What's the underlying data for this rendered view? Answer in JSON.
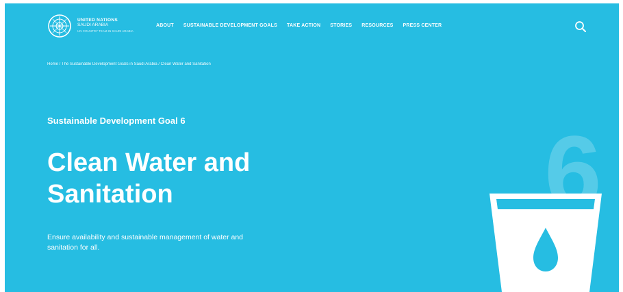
{
  "brand": {
    "line1": "UNITED NATIONS",
    "line2": "SAUDI ARABIA",
    "line3": "UN COUNTRY TEAM IN SAUDI ARABIA"
  },
  "nav": {
    "items": [
      {
        "label": "ABOUT"
      },
      {
        "label": "SUSTAINABLE DEVELOPMENT GOALS"
      },
      {
        "label": "TAKE ACTION"
      },
      {
        "label": "STORIES"
      },
      {
        "label": "RESOURCES"
      },
      {
        "label": "PRESS CENTER"
      }
    ]
  },
  "breadcrumb": "Home / The Sustainable Development Goals in Saudi Arabia / Clean Water and Sanitation",
  "hero": {
    "eyebrow": "Sustainable Development Goal 6",
    "title": "Clean Water and Sanitation",
    "description": "Ensure availability and sustainable management of water and sanitation for all.",
    "goal_number": "6"
  },
  "colors": {
    "background": "#26bde2",
    "text": "#ffffff"
  },
  "icons": {
    "search": "search-icon",
    "emblem": "un-emblem-icon",
    "glass": "water-glass-icon"
  }
}
